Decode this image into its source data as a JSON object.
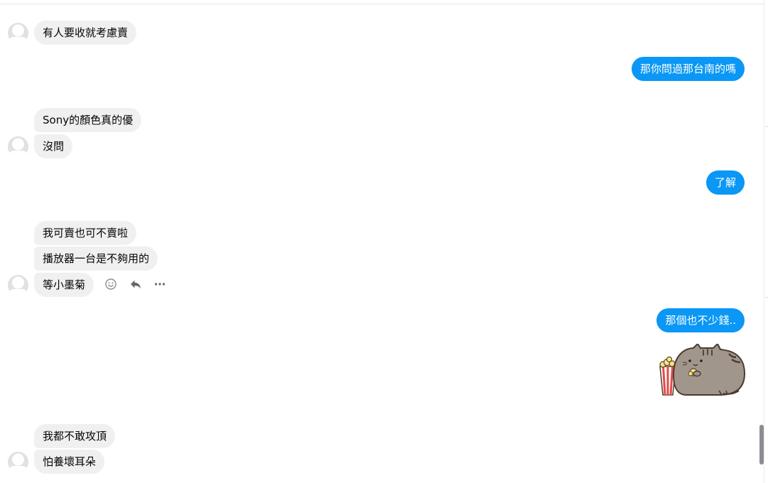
{
  "conversation": {
    "messages": [
      {
        "direction": "in",
        "text": "有人要收就考慮賣"
      },
      {
        "direction": "out",
        "text": "那你問過那台南的嗎"
      },
      {
        "direction": "in",
        "text": "Sony的顏色真的優"
      },
      {
        "direction": "in",
        "text": "沒問"
      },
      {
        "direction": "out",
        "text": "了解"
      },
      {
        "direction": "in",
        "text": "我可賣也可不賣啦"
      },
      {
        "direction": "in",
        "text": "播放器一台是不夠用的"
      },
      {
        "direction": "in",
        "text": "等小墨菊"
      },
      {
        "direction": "out",
        "text": "那個也不少錢.."
      },
      {
        "direction": "out",
        "type": "sticker",
        "sticker": "pusheen-popcorn-sticker"
      },
      {
        "direction": "in",
        "text": "我都不敢攻頂"
      },
      {
        "direction": "in",
        "text": "怕養壞耳朵"
      }
    ]
  },
  "message_actions": {
    "icons": [
      "smiley-react-icon",
      "reply-icon",
      "more-options-icon"
    ]
  },
  "colors": {
    "outgoing_bubble": "#0a97f5",
    "incoming_bubble": "#f0f0f0",
    "incoming_text": "#050505",
    "outgoing_text": "#ffffff"
  }
}
